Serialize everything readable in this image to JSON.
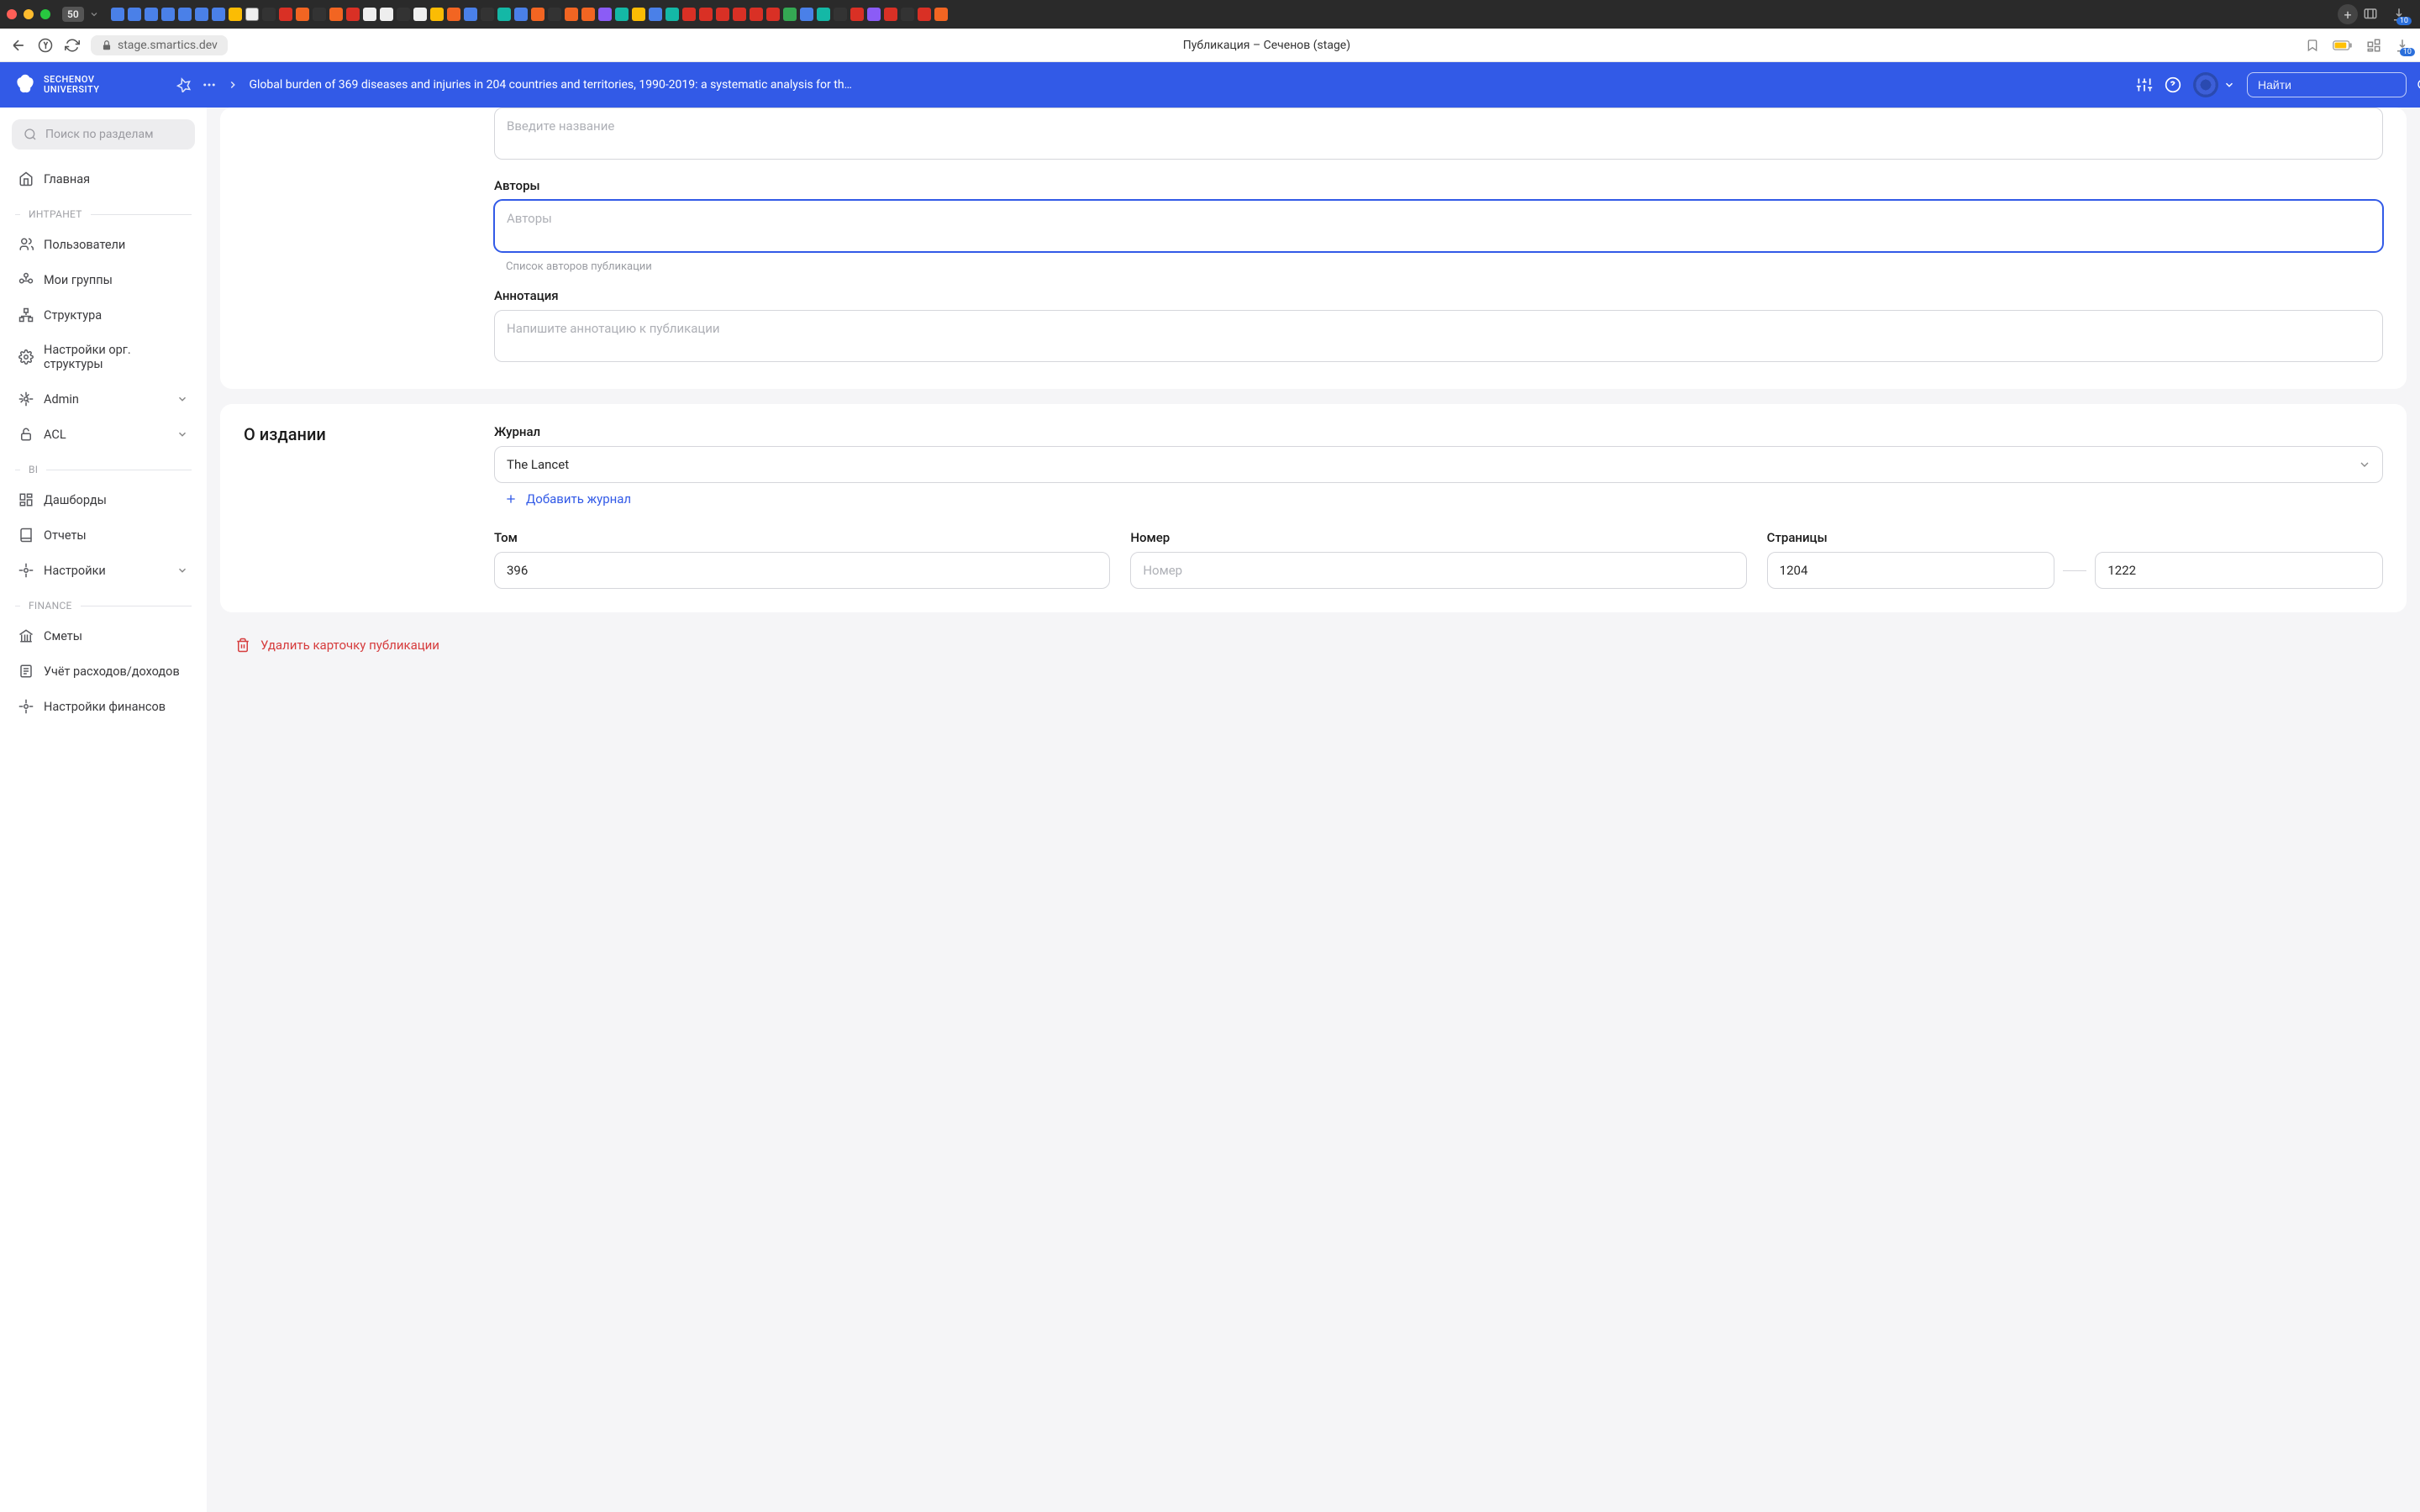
{
  "os_chrome": {
    "tab_count": "50",
    "download_count": "10"
  },
  "browser": {
    "url": "stage.smartics.dev",
    "page_title": "Публикация – Сеченов (stage)"
  },
  "app_header": {
    "logo_line1": "Sechenov",
    "logo_line2": "University",
    "breadcrumb_title": "Global burden of 369 diseases and injuries in 204 countries and territories, 1990-2019: a systematic analysis for th…",
    "search_placeholder": "Найти"
  },
  "sidebar": {
    "search_placeholder": "Поиск по разделам",
    "home": "Главная",
    "sections": {
      "intranet": "ИНТРАНЕТ",
      "bi": "BI",
      "finance": "FINANCE"
    },
    "items": {
      "users": "Пользователи",
      "groups": "Мои группы",
      "structure": "Структура",
      "org_settings": "Настройки орг. структуры",
      "admin": "Admin",
      "acl": "ACL",
      "dashboards": "Дашборды",
      "reports": "Отчеты",
      "settings": "Настройки",
      "estimates": "Сметы",
      "accounting": "Учёт расходов/доходов",
      "fin_settings": "Настройки финансов"
    }
  },
  "form": {
    "title_placeholder": "Введите название",
    "authors_label": "Авторы",
    "authors_placeholder": "Авторы",
    "authors_hint": "Список авторов публикации",
    "annotation_label": "Аннотация",
    "annotation_placeholder": "Напишите аннотацию к публикации"
  },
  "edition": {
    "section_title": "О издании",
    "journal_label": "Журнал",
    "journal_value": "The Lancet",
    "add_journal": "Добавить журнал",
    "volume_label": "Том",
    "volume_value": "396",
    "issue_label": "Номер",
    "issue_placeholder": "Номер",
    "pages_label": "Страницы",
    "pages_from": "1204",
    "pages_to": "1222"
  },
  "actions": {
    "delete": "Удалить карточку публикации"
  }
}
